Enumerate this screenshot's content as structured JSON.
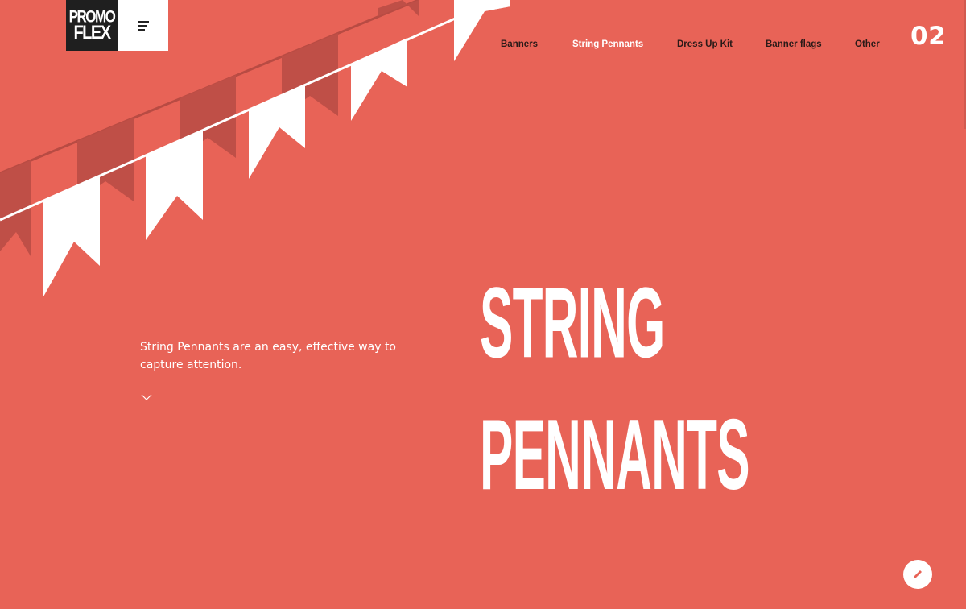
{
  "brand": {
    "logo_line1": "PROMO",
    "logo_line2": "FLEX"
  },
  "header": {
    "menu_icon": "hamburger-menu-icon",
    "nav": [
      {
        "label": "Banners",
        "active": false
      },
      {
        "label": "String Pennants",
        "active": true
      },
      {
        "label": "Dress Up Kit",
        "active": false
      },
      {
        "label": "Banner flags",
        "active": false
      },
      {
        "label": "Other",
        "active": false
      }
    ],
    "page_number": "02"
  },
  "hero": {
    "title_line1": "STRING",
    "title_line2": "PENNANTS",
    "description": "String Pennants are an easy, effective way to capture attention.",
    "scroll_icon": "chevron-down-icon"
  },
  "fab": {
    "icon": "pencil-icon"
  },
  "colors": {
    "background": "#e86357",
    "pennant_light": "#ffffff",
    "pennant_dark": "#bf4f47",
    "logo_bg": "#1f1f1f",
    "text": "#ffffff",
    "nav_text": "#2a1a18"
  }
}
